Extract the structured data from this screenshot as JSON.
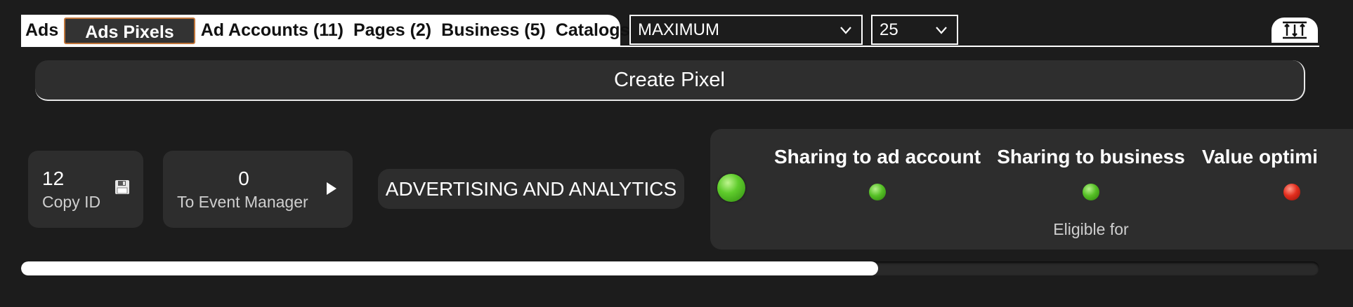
{
  "tabs": {
    "ads": "Ads",
    "ads_pixels": "Ads Pixels",
    "ad_accounts": "Ad Accounts (11)",
    "pages": "Pages (2)",
    "business": "Business (5)",
    "catalogs": "Catalogs"
  },
  "filters": {
    "limit_mode": "MAXIMUM",
    "page_size": "25"
  },
  "create_pixel_label": "Create Pixel",
  "pixel": {
    "id_value": "12",
    "copy_id_label": "Copy ID",
    "events_value": "0",
    "event_manager_label": "To Event Manager",
    "category": "ADVERTISING AND ANALYTICS",
    "overall_status": "green",
    "sharing_ad_account_label": "Sharing to ad account",
    "sharing_ad_account_status": "green",
    "sharing_business_label": "Sharing to business",
    "sharing_business_status": "green",
    "value_optimization_label": "Value optimi",
    "value_optimization_status": "red",
    "eligible_label": "Eligible for"
  },
  "progress_fraction": 0.66,
  "colors": {
    "background": "#1c1c1c",
    "card": "#2d2d2d",
    "active_tab_border": "#c0753a",
    "status_green": "#56c026",
    "status_red": "#e22d1d"
  },
  "icons": {
    "copy": "floppy-disk-icon",
    "event_manager": "play-triangle-icon",
    "toggle": "sort-arrows-icon",
    "select_chevron": "chevron-down-icon"
  }
}
